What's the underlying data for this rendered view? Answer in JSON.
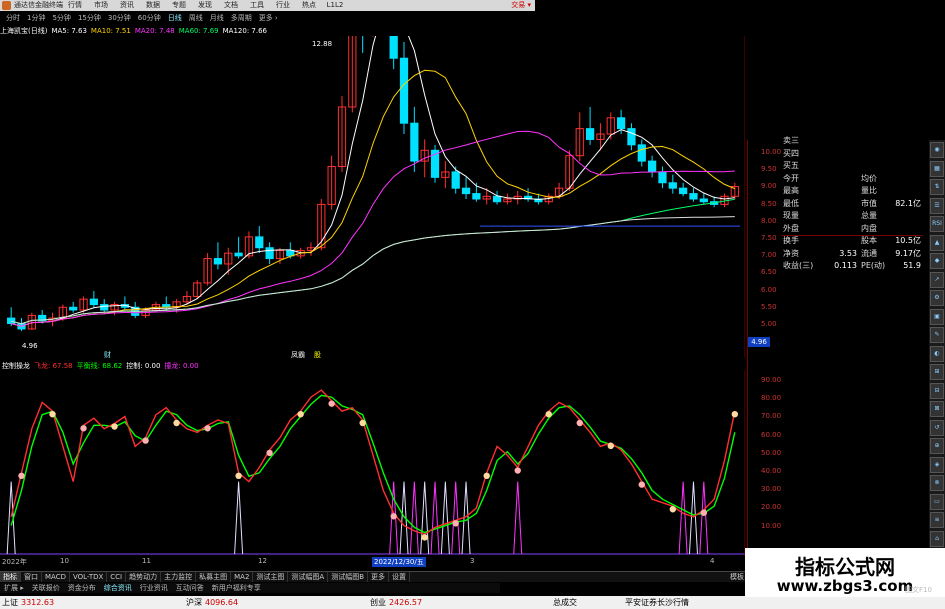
{
  "titlebar": {
    "app": "通达信金融终端",
    "login": "交易 ▾"
  },
  "menu": [
    "行情",
    "市场",
    "资讯",
    "数据",
    "专题",
    "发现",
    "文档",
    "工具",
    "行业",
    "热点",
    "L1L2"
  ],
  "periods": [
    {
      "label": "分时",
      "cls": ""
    },
    {
      "label": "1分钟",
      "cls": ""
    },
    {
      "label": "5分钟",
      "cls": ""
    },
    {
      "label": "15分钟",
      "cls": ""
    },
    {
      "label": "30分钟",
      "cls": ""
    },
    {
      "label": "60分钟",
      "cls": ""
    },
    {
      "label": "日线",
      "cls": "day"
    },
    {
      "label": "周线",
      "cls": ""
    },
    {
      "label": "月线",
      "cls": ""
    },
    {
      "label": "多周期",
      "cls": ""
    },
    {
      "label": "更多 ›",
      "cls": ""
    }
  ],
  "ma_bar": [
    {
      "text": "上海凯宝(日线)",
      "color": "#ffffff"
    },
    {
      "text": "MA5: 7.63",
      "color": "#ffffff"
    },
    {
      "text": "MA10: 7.51",
      "color": "#ffd400"
    },
    {
      "text": "MA20: 7.48",
      "color": "#ff33ff"
    },
    {
      "text": "MA60: 7.69",
      "color": "#00ff66"
    },
    {
      "text": "MA120: 7.66",
      "color": "#ffffff"
    }
  ],
  "price_labels": {
    "high": "12.88",
    "low": "4.96",
    "low_box": "4.96"
  },
  "price_axis": [
    "10.00",
    "9.50",
    "9.00",
    "8.50",
    "8.00",
    "7.50",
    "7.00",
    "6.50",
    "6.00",
    "5.50",
    "5.00"
  ],
  "osc_axis": [
    "90.00",
    "80.00",
    "70.00",
    "60.00",
    "50.00",
    "40.00",
    "30.00",
    "20.00",
    "10.00"
  ],
  "sub_bar": [
    {
      "text": "控制操龙",
      "color": "#ffffff"
    },
    {
      "text": "飞龙: 67.58",
      "color": "#ff3030"
    },
    {
      "text": "平衡线: 68.62",
      "color": "#00ff00"
    },
    {
      "text": "控制: 0.00",
      "color": "#ffffff"
    },
    {
      "text": "撞龙: 0.00",
      "color": "#ff33ff"
    }
  ],
  "marks": {
    "m1": "财",
    "m2": "凤霸",
    "m3": "股"
  },
  "dates": {
    "d0": "2022年",
    "d1": "10",
    "d2": "11",
    "d3": "12",
    "cursor": "2022/12/30/五",
    "d5": "3",
    "d6": "4"
  },
  "quote": [
    {
      "k": "卖三",
      "v": "",
      "k2": "",
      "v2": ""
    },
    {
      "k": "买四",
      "v": "",
      "k2": "",
      "v2": ""
    },
    {
      "k": "买五",
      "v": "",
      "k2": "",
      "v2": ""
    },
    {
      "k": "今开",
      "v": "",
      "k2": "均价",
      "v2": ""
    },
    {
      "k": "最高",
      "v": "",
      "k2": "量比",
      "v2": ""
    },
    {
      "k": "最低",
      "v": "",
      "k2": "市值",
      "v2": "82.1亿"
    },
    {
      "k": "现量",
      "v": "",
      "k2": "总量",
      "v2": ""
    },
    {
      "k": "外盘",
      "v": "",
      "k2": "内盘",
      "v2": ""
    },
    {
      "k": "换手",
      "v": "",
      "k2": "股本",
      "v2": "10.5亿"
    },
    {
      "k": "净资",
      "v": "3.53",
      "k2": "流通",
      "v2": "9.17亿"
    },
    {
      "k": "收益(三)",
      "v": "0.113",
      "k2": "PE(动)",
      "v2": "51.9"
    }
  ],
  "right_tools": [
    "◉",
    "▦",
    "⇅",
    "☰",
    "RSI",
    "▲",
    "◆",
    "↗",
    "⚙",
    "▣",
    "✎",
    "◐",
    "⊞",
    "⊟",
    "⊠",
    "↺",
    "⊕",
    "◈",
    "⊗",
    "▭",
    "≡",
    "⌂",
    "✦",
    "▤"
  ],
  "tabs": [
    "指标",
    "窗口",
    "MACD",
    "VOL-TDX",
    "CCI",
    "趋势动力",
    "主力监控",
    "私募主图",
    "MA2",
    "测试主图",
    "测试幅图A",
    "测试幅图B",
    "更多",
    "设置"
  ],
  "tabs_right": "模板",
  "tabs2": [
    {
      "label": "扩展 ▸",
      "cls": ""
    },
    {
      "label": "关联报价",
      "cls": ""
    },
    {
      "label": "资金分布",
      "cls": ""
    },
    {
      "label": "综合资讯",
      "cls": "blue"
    },
    {
      "label": "行业资讯",
      "cls": ""
    },
    {
      "label": "互动问答",
      "cls": ""
    },
    {
      "label": "新用户福利专享",
      "cls": ""
    }
  ],
  "status": [
    {
      "label": "上证",
      "value": "3312.63",
      "x": 2
    },
    {
      "label": "沪深",
      "value": "4096.64",
      "x": 186
    },
    {
      "label": "创业",
      "value": "2426.57",
      "x": 370
    },
    {
      "label": "总成交",
      "value": "",
      "x": 553
    },
    {
      "label": "平安证券长沙行情",
      "value": "",
      "x": 625
    }
  ],
  "watermark": {
    "line1": "指标公式网",
    "line2": "www.zbgs3.com"
  },
  "corner_label": "图文F10",
  "chart_data": {
    "type": "candlestick",
    "title": "上海凯宝(日线)",
    "ylim": [
      4.5,
      10.3
    ],
    "candles": [
      [
        5.2,
        5.4,
        5.05,
        5.1
      ],
      [
        5.1,
        5.2,
        4.96,
        5.0
      ],
      [
        5.0,
        5.3,
        4.98,
        5.25
      ],
      [
        5.25,
        5.35,
        5.1,
        5.15
      ],
      [
        5.15,
        5.3,
        5.05,
        5.2
      ],
      [
        5.2,
        5.45,
        5.15,
        5.4
      ],
      [
        5.4,
        5.5,
        5.3,
        5.35
      ],
      [
        5.35,
        5.6,
        5.3,
        5.55
      ],
      [
        5.55,
        5.7,
        5.4,
        5.45
      ],
      [
        5.45,
        5.55,
        5.3,
        5.35
      ],
      [
        5.35,
        5.5,
        5.25,
        5.45
      ],
      [
        5.45,
        5.6,
        5.35,
        5.4
      ],
      [
        5.4,
        5.5,
        5.2,
        5.25
      ],
      [
        5.25,
        5.4,
        5.2,
        5.35
      ],
      [
        5.35,
        5.5,
        5.3,
        5.45
      ],
      [
        5.45,
        5.6,
        5.35,
        5.4
      ],
      [
        5.4,
        5.55,
        5.3,
        5.5
      ],
      [
        5.5,
        5.7,
        5.45,
        5.6
      ],
      [
        5.6,
        5.9,
        5.55,
        5.85
      ],
      [
        5.85,
        6.4,
        5.8,
        6.3
      ],
      [
        6.3,
        6.6,
        6.1,
        6.2
      ],
      [
        6.2,
        6.5,
        6.0,
        6.4
      ],
      [
        6.4,
        6.7,
        6.3,
        6.35
      ],
      [
        6.35,
        6.8,
        6.3,
        6.7
      ],
      [
        6.7,
        6.9,
        6.4,
        6.5
      ],
      [
        6.5,
        6.6,
        6.2,
        6.3
      ],
      [
        6.3,
        6.5,
        6.2,
        6.45
      ],
      [
        6.45,
        6.6,
        6.3,
        6.35
      ],
      [
        6.35,
        6.5,
        6.3,
        6.45
      ],
      [
        6.45,
        6.6,
        6.35,
        6.5
      ],
      [
        6.5,
        7.4,
        6.45,
        7.3
      ],
      [
        7.3,
        8.2,
        7.2,
        8.0
      ],
      [
        8.0,
        9.3,
        7.9,
        9.1
      ],
      [
        9.1,
        11.5,
        9.0,
        11.2
      ],
      [
        11.2,
        12.1,
        10.1,
        10.5
      ],
      [
        10.5,
        12.88,
        10.4,
        12.4
      ],
      [
        12.4,
        12.6,
        11.0,
        11.4
      ],
      [
        11.4,
        11.7,
        9.8,
        10.0
      ],
      [
        10.0,
        10.3,
        8.6,
        8.8
      ],
      [
        8.8,
        9.1,
        7.9,
        8.1
      ],
      [
        8.1,
        8.5,
        7.8,
        8.3
      ],
      [
        8.3,
        8.4,
        7.7,
        7.8
      ],
      [
        7.8,
        8.1,
        7.6,
        7.9
      ],
      [
        7.9,
        8.0,
        7.5,
        7.6
      ],
      [
        7.6,
        7.8,
        7.4,
        7.5
      ],
      [
        7.5,
        7.7,
        7.35,
        7.4
      ],
      [
        7.4,
        7.6,
        7.3,
        7.45
      ],
      [
        7.45,
        7.55,
        7.3,
        7.35
      ],
      [
        7.35,
        7.5,
        7.3,
        7.4
      ],
      [
        7.4,
        7.55,
        7.3,
        7.45
      ],
      [
        7.45,
        7.6,
        7.35,
        7.4
      ],
      [
        7.4,
        7.5,
        7.3,
        7.35
      ],
      [
        7.35,
        7.5,
        7.3,
        7.45
      ],
      [
        7.45,
        7.7,
        7.4,
        7.6
      ],
      [
        7.6,
        8.3,
        7.55,
        8.2
      ],
      [
        8.2,
        9.0,
        8.1,
        8.7
      ],
      [
        8.7,
        9.1,
        8.4,
        8.5
      ],
      [
        8.5,
        8.8,
        8.3,
        8.6
      ],
      [
        8.6,
        9.0,
        8.5,
        8.9
      ],
      [
        8.9,
        9.05,
        8.6,
        8.7
      ],
      [
        8.7,
        8.8,
        8.3,
        8.4
      ],
      [
        8.4,
        8.5,
        8.0,
        8.1
      ],
      [
        8.1,
        8.2,
        7.8,
        7.9
      ],
      [
        7.9,
        8.0,
        7.6,
        7.7
      ],
      [
        7.7,
        7.85,
        7.5,
        7.6
      ],
      [
        7.6,
        7.7,
        7.45,
        7.5
      ],
      [
        7.5,
        7.6,
        7.35,
        7.4
      ],
      [
        7.4,
        7.5,
        7.3,
        7.35
      ],
      [
        7.35,
        7.45,
        7.25,
        7.3
      ],
      [
        7.3,
        7.5,
        7.25,
        7.45
      ],
      [
        7.45,
        7.7,
        7.4,
        7.63
      ]
    ],
    "oscillator": {
      "ylim": [
        0,
        100
      ],
      "fast": [
        20,
        45,
        70,
        85,
        80,
        60,
        40,
        72,
        76,
        70,
        73,
        77,
        60,
        65,
        78,
        82,
        75,
        70,
        68,
        72,
        75,
        73,
        45,
        40,
        48,
        58,
        65,
        75,
        80,
        88,
        92,
        86,
        80,
        82,
        75,
        55,
        35,
        22,
        15,
        12,
        10,
        14,
        16,
        18,
        20,
        25,
        45,
        60,
        55,
        48,
        60,
        72,
        80,
        85,
        82,
        75,
        68,
        60,
        62,
        58,
        50,
        40,
        30,
        28,
        26,
        22,
        20,
        24,
        30,
        52,
        80
      ],
      "slow": [
        15,
        35,
        60,
        78,
        80,
        68,
        50,
        62,
        72,
        72,
        71,
        74,
        66,
        63,
        72,
        80,
        78,
        72,
        69,
        70,
        73,
        74,
        55,
        43,
        45,
        53,
        60,
        70,
        77,
        84,
        89,
        88,
        83,
        81,
        78,
        62,
        45,
        30,
        20,
        14,
        11,
        13,
        15,
        17,
        18,
        22,
        35,
        52,
        57,
        50,
        56,
        67,
        76,
        82,
        83,
        78,
        71,
        63,
        61,
        59,
        53,
        45,
        35,
        30,
        27,
        24,
        21,
        22,
        26,
        42,
        68
      ]
    },
    "series": [
      {
        "name": "MA5",
        "values": [
          7.63
        ]
      },
      {
        "name": "MA10",
        "values": [
          7.51
        ]
      },
      {
        "name": "MA20",
        "values": [
          7.48
        ]
      },
      {
        "name": "MA60",
        "values": [
          7.69
        ]
      },
      {
        "name": "MA120",
        "values": [
          7.66
        ]
      }
    ]
  }
}
